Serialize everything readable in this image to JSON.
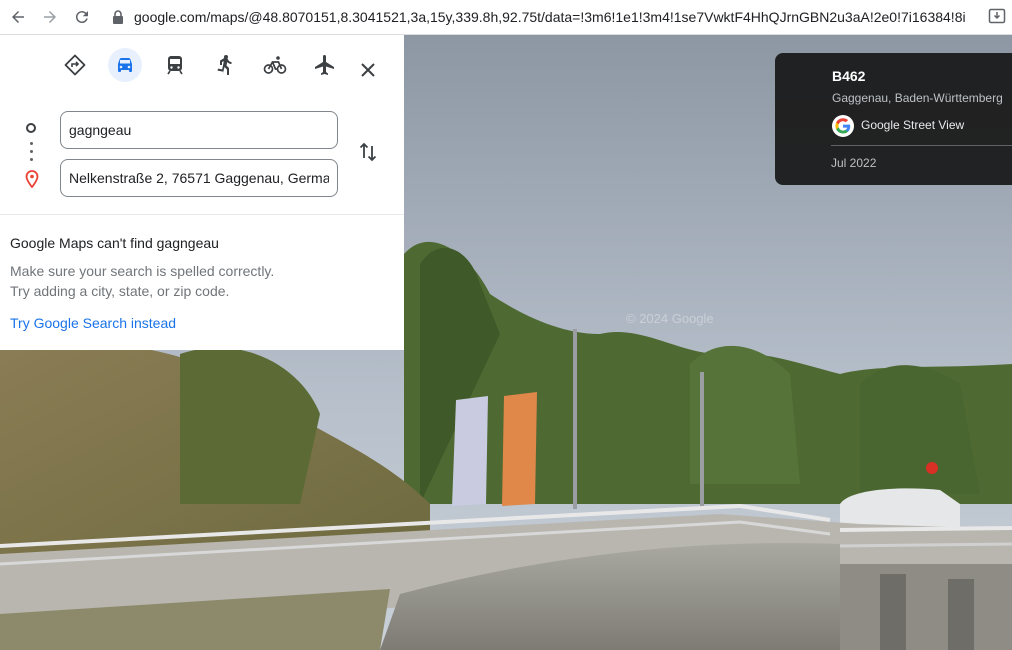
{
  "browser": {
    "url": "google.com/maps/@48.8070151,8.3041521,3a,15y,339.8h,92.75t/data=!3m6!1e1!3m4!1se7VwktF4HhQJrnGBN2u3aA!2e0!7i16384!8i8..."
  },
  "directions": {
    "origin_value": "gagngeau",
    "destination_value": "Nelkenstraße 2, 76571 Gaggenau, Germa",
    "travel_modes": [
      "best-route",
      "driving",
      "transit",
      "walking",
      "cycling",
      "flights"
    ],
    "active_mode": "driving"
  },
  "error": {
    "title": "Google Maps can't find gagngeau",
    "line1": "Make sure your search is spelled correctly.",
    "line2": "Try adding a city, state, or zip code.",
    "link": "Try Google Search instead"
  },
  "streetview": {
    "road": "B462",
    "locality": "Gaggenau, Baden-Württemberg",
    "source": "Google Street View",
    "date": "Jul 2022",
    "watermark": "© 2024 Google"
  },
  "colors": {
    "accent": "#1a73e8",
    "active_mode_bg": "#e8f0fe",
    "pin_red": "#ea4335"
  }
}
